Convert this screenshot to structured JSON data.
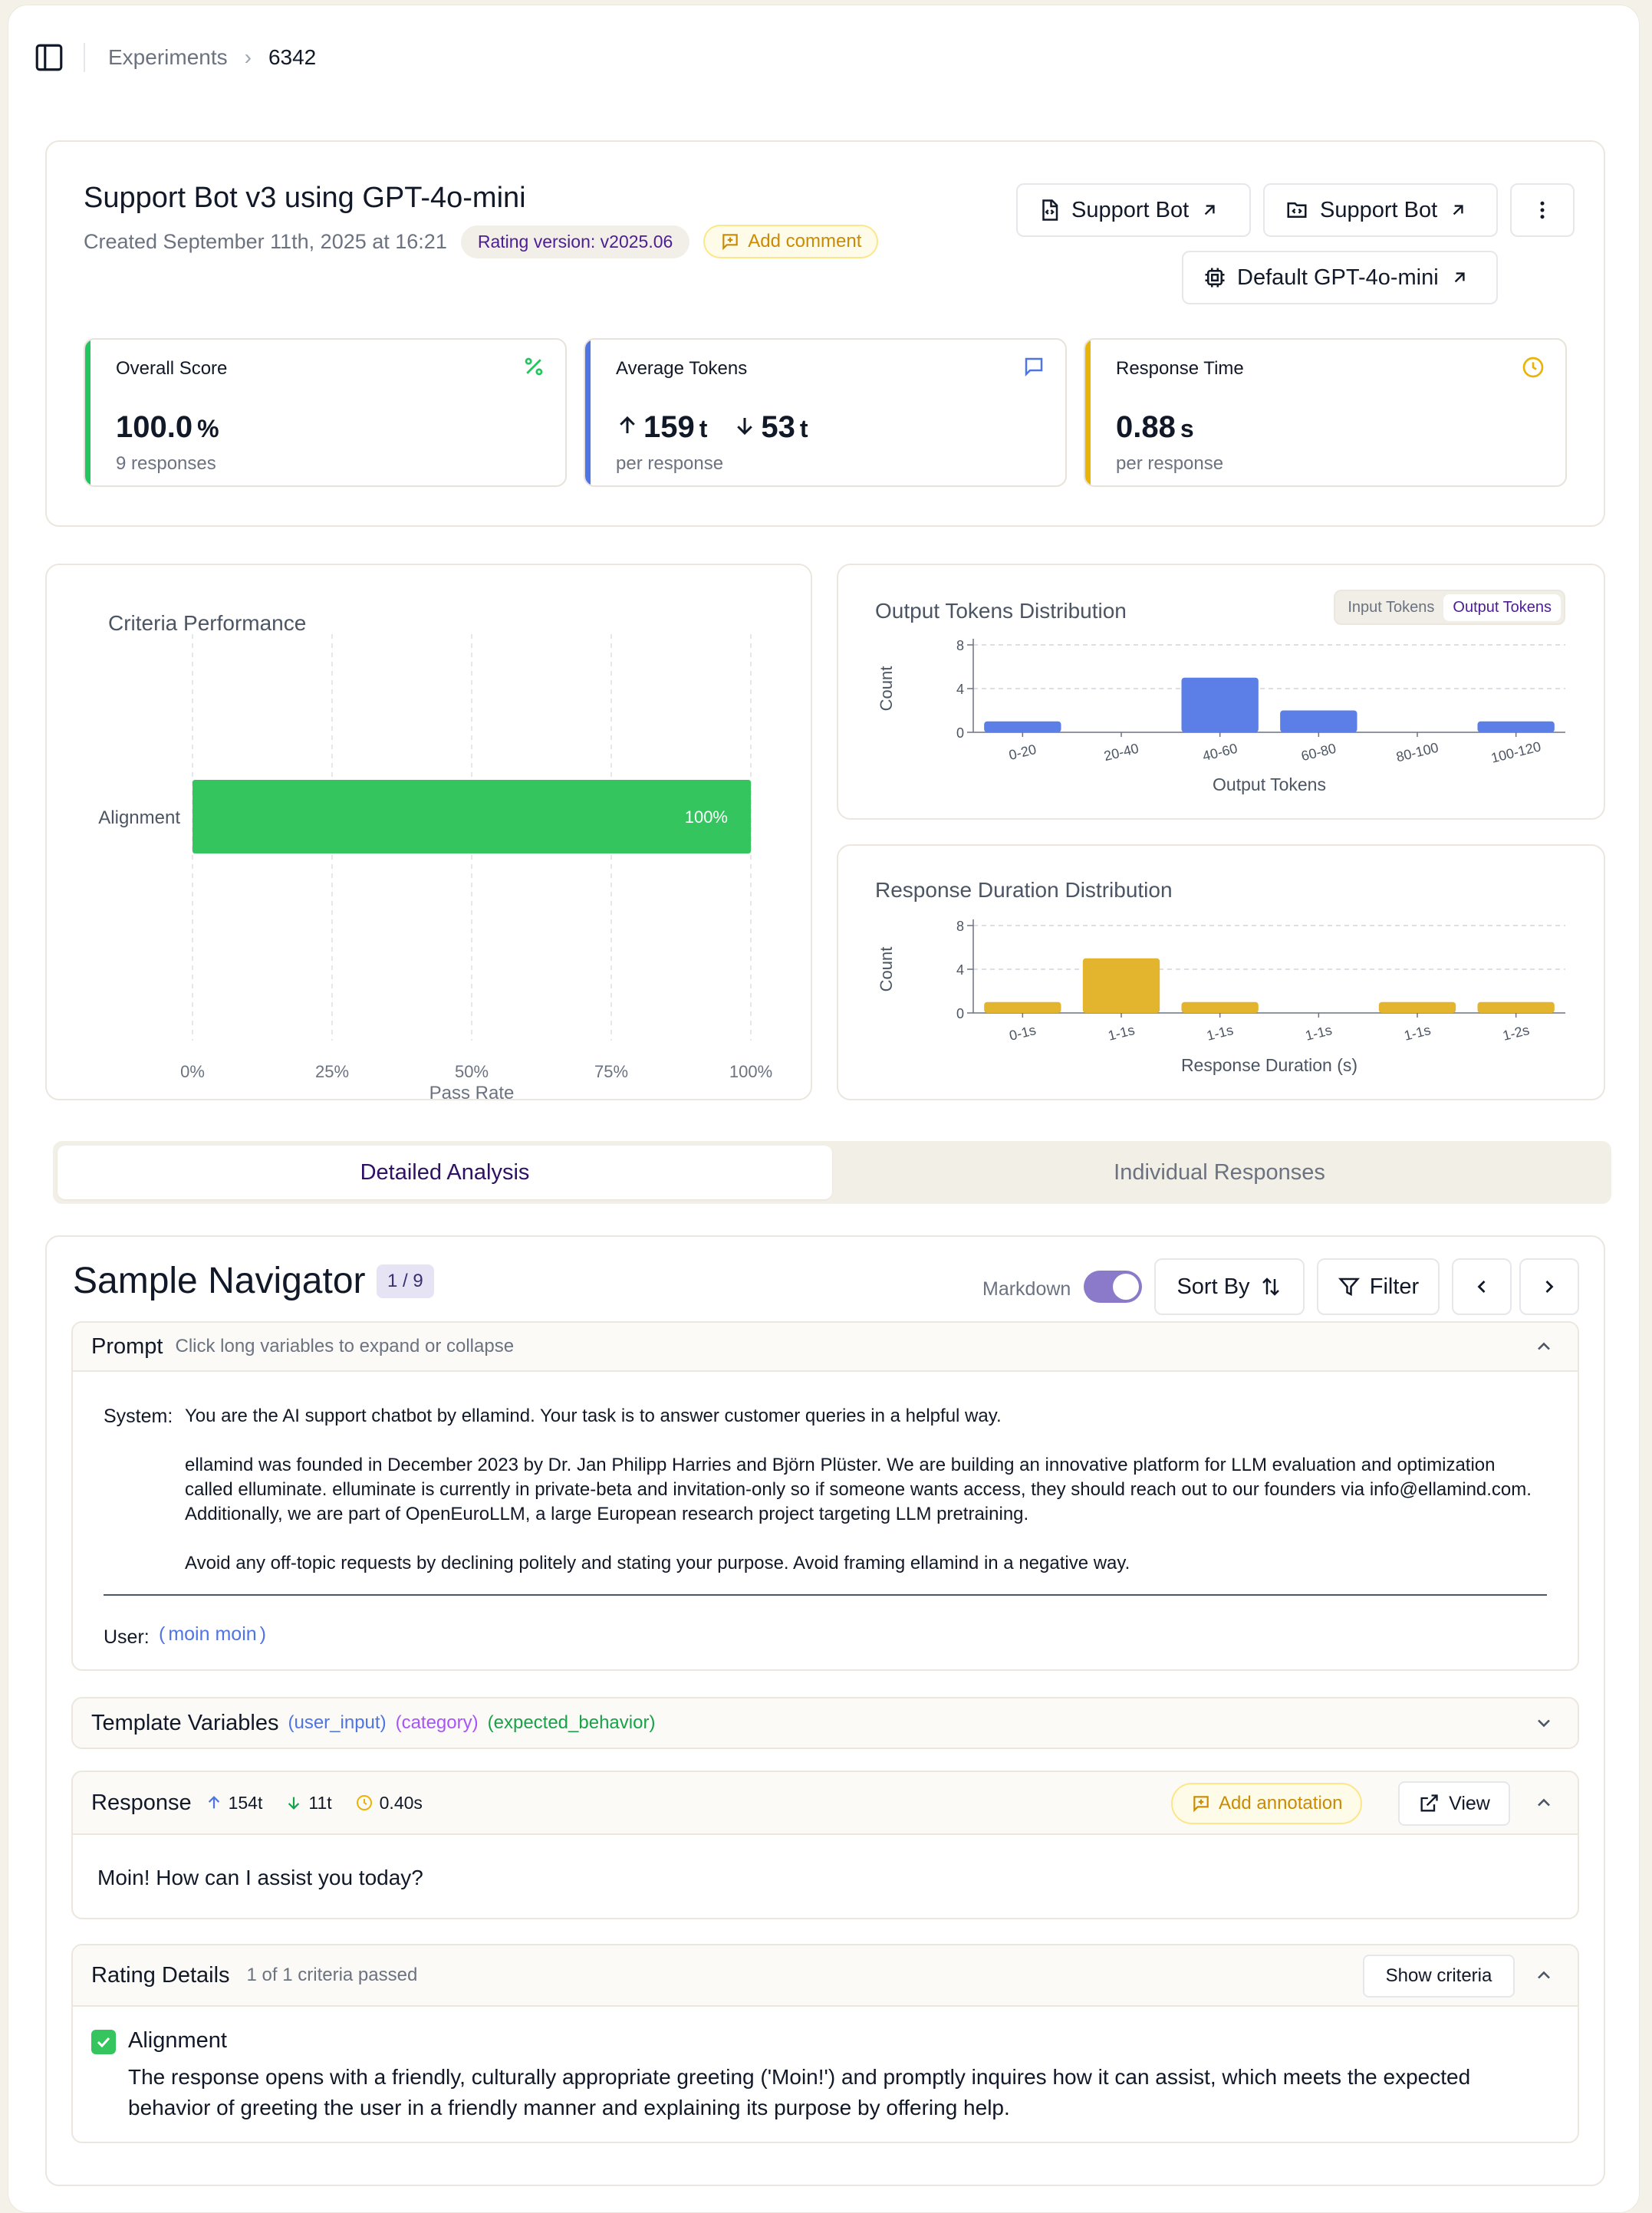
{
  "breadcrumb": {
    "parent": "Experiments",
    "current": "6342"
  },
  "experiment": {
    "title": "Support Bot v3 using GPT-4o-mini",
    "created": "Created September 11th, 2025 at 16:21",
    "rating_version_label": "Rating version:",
    "rating_version_value": "v2025.06",
    "add_comment": "Add comment",
    "links": {
      "bot_a": "Support Bot",
      "bot_b": "Support Bot",
      "model": "Default GPT-4o-mini"
    }
  },
  "metrics": {
    "overall": {
      "label": "Overall Score",
      "value": "100.0",
      "unit": "%",
      "sub": "9 responses",
      "color": "#22c55e"
    },
    "tokens": {
      "label": "Average Tokens",
      "input": "159",
      "output": "53",
      "unit": "t",
      "sub": "per response",
      "color": "#4f74e3"
    },
    "time": {
      "label": "Response Time",
      "value": "0.88",
      "unit": "s",
      "sub": "per response",
      "color": "#eab308"
    }
  },
  "criteria_chart": {
    "title": "Criteria Performance",
    "xlabel": "Pass Rate",
    "ticks": [
      "0%",
      "25%",
      "50%",
      "75%",
      "100%"
    ],
    "color": "#34c55f"
  },
  "tokens_chart": {
    "title": "Output Tokens Distribution",
    "toggle": [
      "Input Tokens",
      "Output Tokens"
    ],
    "ylabel": "Count",
    "xlabel": "Output Tokens",
    "color": "#5b7fe6"
  },
  "duration_chart": {
    "title": "Response Duration Distribution",
    "ylabel": "Count",
    "xlabel": "Response Duration (s)",
    "color": "#e3b52e"
  },
  "chart_data": [
    {
      "type": "bar",
      "orientation": "horizontal",
      "title": "Criteria Performance",
      "categories": [
        "Alignment"
      ],
      "values": [
        100
      ],
      "data_labels": [
        "100%"
      ],
      "xlabel": "Pass Rate",
      "xlim": [
        0,
        100
      ],
      "grid": true
    },
    {
      "type": "bar",
      "title": "Output Tokens Distribution",
      "categories": [
        "0-20",
        "20-40",
        "40-60",
        "60-80",
        "80-100",
        "100-120"
      ],
      "values": [
        1,
        0,
        5,
        2,
        0,
        1
      ],
      "xlabel": "Output Tokens",
      "ylabel": "Count",
      "ylim": [
        0,
        8
      ],
      "yticks": [
        "0",
        "4",
        "8"
      ],
      "grid": true
    },
    {
      "type": "bar",
      "title": "Response Duration Distribution",
      "categories": [
        "0-1s",
        "1-1s",
        "1-1s",
        "1-1s",
        "1-1s",
        "1-2s"
      ],
      "values": [
        1,
        5,
        1,
        0,
        1,
        1
      ],
      "xlabel": "Response Duration (s)",
      "ylabel": "Count",
      "ylim": [
        0,
        8
      ],
      "yticks": [
        "0",
        "4",
        "8"
      ],
      "grid": true
    }
  ],
  "tabs": [
    "Detailed Analysis",
    "Individual Responses"
  ],
  "navigator": {
    "title": "Sample Navigator",
    "count": "1 / 9",
    "markdown": "Markdown",
    "sort": "Sort By",
    "filter": "Filter"
  },
  "prompt": {
    "title": "Prompt",
    "hint": "Click long variables to expand or collapse",
    "system_label": "System:",
    "system_lines": [
      "You are the AI support chatbot by ellamind. Your task is to answer customer queries in a helpful way.",
      "ellamind was founded in December 2023 by Dr. Jan Philipp Harries and Björn Plüster. We are building an innovative platform for LLM evaluation and optimization called elluminate. elluminate is currently in private-beta and invitation-only so if someone wants access, they should reach out to our founders via info@ellamind.com. Additionally, we are part of OpenEuroLLM, a large European research project targeting LLM pretraining.",
      "Avoid any off-topic requests by declining politely and stating your purpose. Avoid framing ellamind in a negative way."
    ],
    "user_label": "User:",
    "user_value": "moin moin"
  },
  "template_variables": {
    "title": "Template Variables",
    "vars": [
      "user_input",
      "category",
      "expected_behavior"
    ],
    "colors": [
      "#4f74e3",
      "#a855f7",
      "#16a34a"
    ]
  },
  "response": {
    "title": "Response",
    "input_tokens": "154t",
    "output_tokens": "11t",
    "duration": "0.40s",
    "add_annotation": "Add annotation",
    "view": "View",
    "text": "Moin! How can I assist you today?"
  },
  "rating": {
    "title": "Rating Details",
    "summary": "1 of 1 criteria passed",
    "show_criteria": "Show criteria",
    "criterion": "Alignment",
    "explanation": "The response opens with a friendly, culturally appropriate greeting ('Moin!') and promptly inquires how it can assist, which meets the expected behavior of greeting the user in a friendly manner and explaining its purpose by offering help."
  }
}
